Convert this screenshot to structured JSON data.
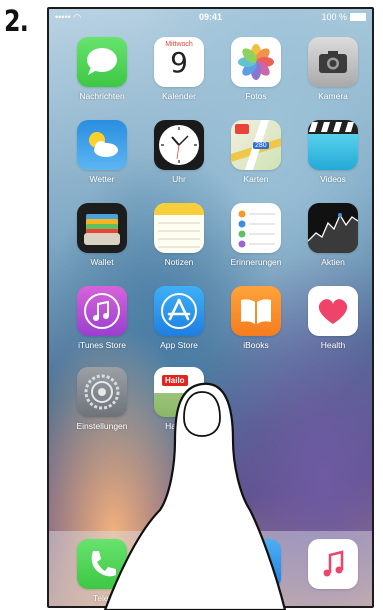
{
  "step_label": "2.",
  "status_bar": {
    "signal": "••••• ◠",
    "time": "09:41",
    "battery": "100 %"
  },
  "calendar": {
    "weekday": "Mittwoch",
    "day": "9"
  },
  "apps": [
    {
      "label": "Nachrichten",
      "icon": "messages-icon"
    },
    {
      "label": "Kalender",
      "icon": "calendar-icon"
    },
    {
      "label": "Fotos",
      "icon": "photos-icon"
    },
    {
      "label": "Kamera",
      "icon": "camera-icon"
    },
    {
      "label": "Wetter",
      "icon": "weather-icon"
    },
    {
      "label": "Uhr",
      "icon": "clock-icon"
    },
    {
      "label": "Karten",
      "icon": "maps-icon"
    },
    {
      "label": "Videos",
      "icon": "videos-icon"
    },
    {
      "label": "Wallet",
      "icon": "wallet-icon"
    },
    {
      "label": "Notizen",
      "icon": "notes-icon"
    },
    {
      "label": "Erinnerungen",
      "icon": "reminders-icon"
    },
    {
      "label": "Aktien",
      "icon": "stocks-icon"
    },
    {
      "label": "iTunes Store",
      "icon": "itunes-store-icon"
    },
    {
      "label": "App Store",
      "icon": "app-store-icon"
    },
    {
      "label": "iBooks",
      "icon": "ibooks-icon"
    },
    {
      "label": "Health",
      "icon": "health-icon"
    },
    {
      "label": "Einstellungen",
      "icon": "settings-icon"
    },
    {
      "label": "Hailo H",
      "icon": "hailo-icon"
    }
  ],
  "hailo_logo": "Hailo",
  "maps_badge": "280",
  "dock": [
    {
      "label": "Telef",
      "icon": "phone-icon"
    },
    {
      "label": "",
      "icon": "safari-icon"
    },
    {
      "label": "",
      "icon": "mail-icon"
    },
    {
      "label": "",
      "icon": "music-icon"
    }
  ],
  "colors": {
    "accent_red": "#e8443a",
    "messages_green": "#4cd964",
    "appstore_blue": "#1e90f0"
  }
}
